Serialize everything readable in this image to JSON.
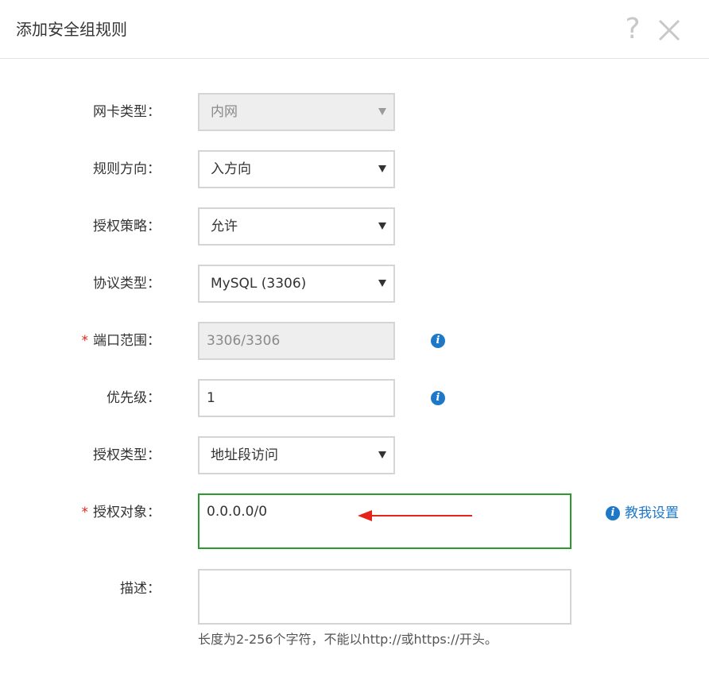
{
  "dialog": {
    "title": "添加安全组规则",
    "help_glyph": "?",
    "close_icon": "close-icon"
  },
  "form": {
    "nic_type": {
      "label": "网卡类型：",
      "value": "内网",
      "disabled": true
    },
    "direction": {
      "label": "规则方向：",
      "value": "入方向"
    },
    "policy": {
      "label": "授权策略：",
      "value": "允许"
    },
    "protocol": {
      "label": "协议类型：",
      "value": "MySQL (3306)"
    },
    "port_range": {
      "required_mark": "*",
      "label": "端口范围：",
      "value": "3306/3306",
      "disabled": true
    },
    "priority": {
      "label": "优先级：",
      "value": "1"
    },
    "auth_type": {
      "label": "授权类型：",
      "value": "地址段访问"
    },
    "auth_object": {
      "required_mark": "*",
      "label": "授权对象：",
      "value": "0.0.0.0/0",
      "help_link": "教我设置"
    },
    "description": {
      "label": "描述：",
      "value": "",
      "hint": "长度为2-256个字符，不能以http://或https://开头。"
    }
  },
  "info_glyph": "i",
  "colors": {
    "link": "#1e78c8",
    "required": "#e5231b",
    "focus_border": "#2e9a2e",
    "annotation_arrow": "#e5231b"
  }
}
